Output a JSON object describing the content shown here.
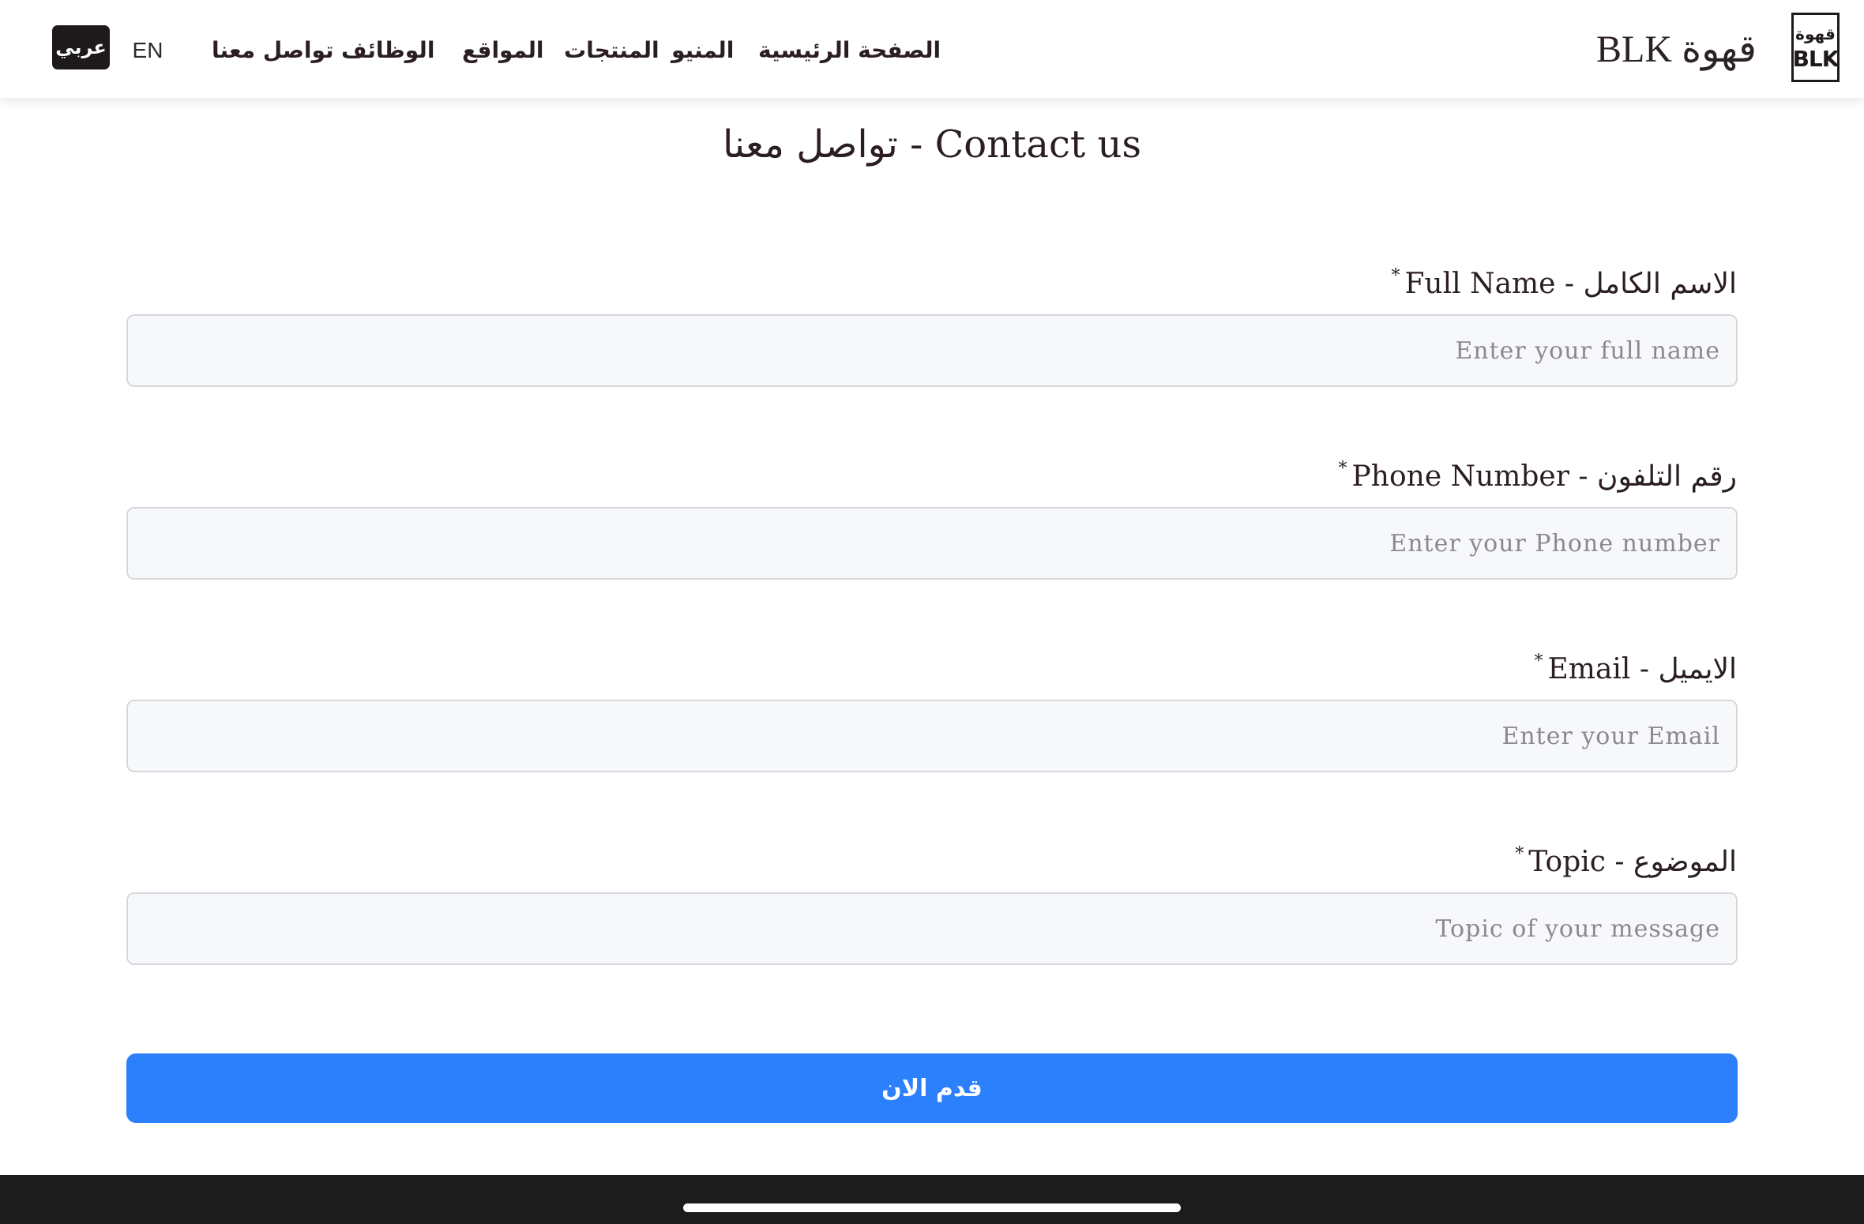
{
  "header": {
    "lang_ar": "عربي",
    "lang_en": "EN",
    "nav": [
      "تواصل معنا",
      "الوظائف",
      "المواقع",
      "المنتجات",
      "المنيو",
      "الصفحة الرئيسية"
    ],
    "brand": "BLK قهوة",
    "logo_top": "قهوة",
    "logo_bottom": "BLK"
  },
  "page": {
    "title": "تواصل معنا - Contact us"
  },
  "form": {
    "fields": [
      {
        "label": "Full Name - الاسم الكامل",
        "required": "*",
        "placeholder": "Enter your full name"
      },
      {
        "label": "Phone Number - رقم التلفون",
        "required": "*",
        "placeholder": "Enter your Phone number"
      },
      {
        "label": "Email - الايميل",
        "required": "*",
        "placeholder": "Enter your Email"
      },
      {
        "label": "Topic - الموضوع",
        "required": "*",
        "placeholder": "Topic of your message"
      }
    ],
    "submit_label": "قدم الان"
  },
  "colors": {
    "primary": "#2d80fc",
    "text": "#1e1a1c",
    "input_bg": "#f7f8fa",
    "input_border": "#d6d8de"
  }
}
